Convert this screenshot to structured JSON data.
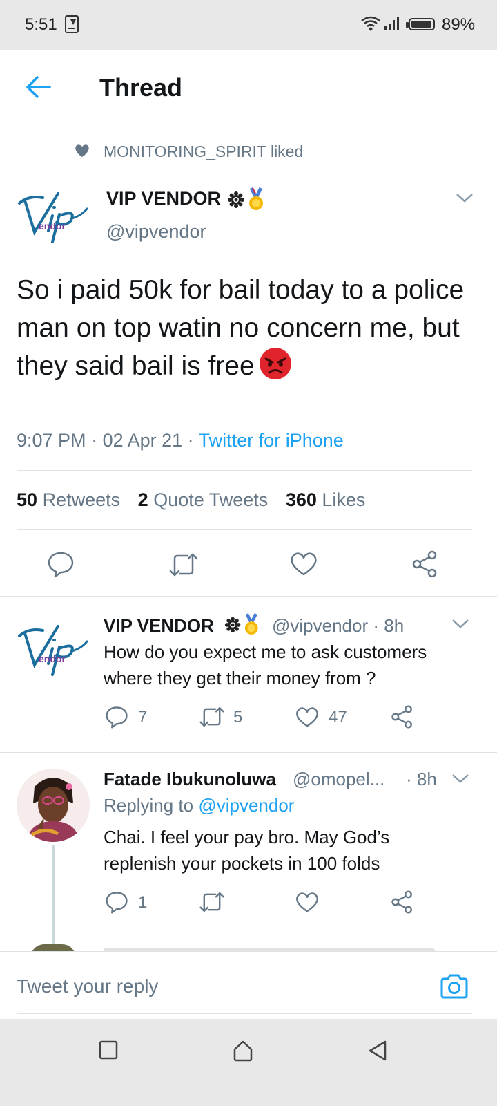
{
  "status_bar": {
    "time": "5:51",
    "battery": "89%",
    "icons": [
      "download-icon",
      "wifi-icon",
      "signal-icon",
      "battery-icon"
    ]
  },
  "header": {
    "title": "Thread"
  },
  "social_context": {
    "text": "MONITORING_SPIRIT liked"
  },
  "main_tweet": {
    "display_name": "VIP VENDOR",
    "handle": "@vipvendor",
    "logo_text": "endor",
    "text": "So i paid 50k for bail today to a police man on top watin no concern me, but they said bail is free",
    "time": "9:07 PM",
    "date": "02 Apr 21",
    "source": "Twitter for iPhone",
    "separator": " · "
  },
  "stats": {
    "retweets_count": "50",
    "retweets_label": "Retweets",
    "quotes_count": "2",
    "quotes_label": "Quote Tweets",
    "likes_count": "360",
    "likes_label": "Likes"
  },
  "replies": [
    {
      "display_name": "VIP VENDOR",
      "handle": "@vipvendor",
      "time": "· 8h",
      "logo_text": "endor",
      "text_line1": "How do you expect me to ask customers",
      "text_line2": "where they get their money from ?",
      "reply_count": "7",
      "retweet_count": "5",
      "like_count": "47"
    },
    {
      "display_name": "Fatade Ibukunoluwa",
      "handle": "@omopel...",
      "time": "· 8h",
      "replying_label": "Replying to",
      "replying_to": "@vipvendor",
      "text_line1": "Chai. I feel your pay bro. May God’s",
      "text_line2": "replenish your pockets in 100 folds",
      "reply_count": "1",
      "retweet_count": "",
      "like_count": ""
    }
  ],
  "compose": {
    "placeholder": "Tweet your reply"
  },
  "colors": {
    "accent": "#1da1f2",
    "secondary_text": "#657786",
    "primary_text": "#14171a",
    "divider": "#dde2e6",
    "system_bar": "#e8e8e8"
  }
}
